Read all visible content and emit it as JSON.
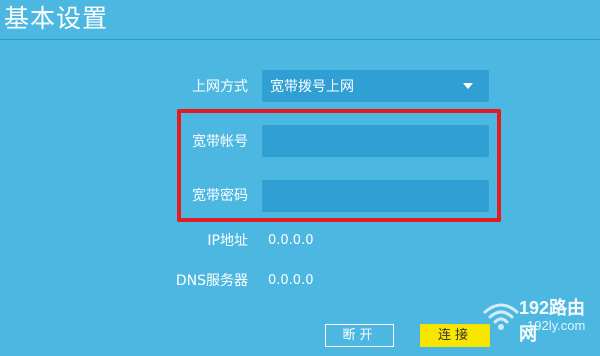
{
  "header": {
    "title": "基本设置"
  },
  "form": {
    "connection_type": {
      "label": "上网方式",
      "value": "宽带拨号上网"
    },
    "account": {
      "label": "宽带帐号",
      "value": ""
    },
    "password": {
      "label": "宽带密码",
      "value": ""
    },
    "ip": {
      "label": "IP地址",
      "value": "0.0.0.0"
    },
    "dns": {
      "label": "DNS服务器",
      "value": "0.0.0.0"
    }
  },
  "buttons": {
    "disconnect": "断开",
    "connect": "连接"
  },
  "watermark": {
    "brand": "192路由网",
    "url": "192ly.com"
  },
  "colors": {
    "background": "#4cb8e2",
    "field": "#2f9fd4",
    "highlight": "#e31b22",
    "connect_button": "#f6e600"
  },
  "icons": {
    "dropdown": "caret-down-icon",
    "watermark_logo": "wifi-icon"
  }
}
